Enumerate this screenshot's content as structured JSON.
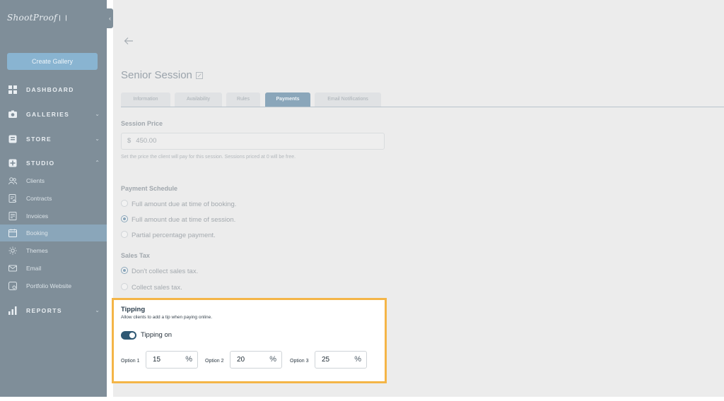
{
  "sidebar": {
    "logo_text": "ShootProof",
    "create_button": "Create Gallery",
    "sections": [
      {
        "label": "DASHBOARD",
        "icon": "grid-icon"
      },
      {
        "label": "GALLERIES",
        "icon": "camera-icon"
      },
      {
        "label": "STORE",
        "icon": "store-icon"
      },
      {
        "label": "STUDIO",
        "icon": "studio-icon"
      },
      {
        "label": "REPORTS",
        "icon": "bar-chart-icon"
      }
    ],
    "studio_items": [
      {
        "label": "Clients",
        "icon": "users-icon"
      },
      {
        "label": "Contracts",
        "icon": "contract-icon"
      },
      {
        "label": "Invoices",
        "icon": "invoice-icon"
      },
      {
        "label": "Booking",
        "icon": "calendar-icon"
      },
      {
        "label": "Themes",
        "icon": "sun-icon"
      },
      {
        "label": "Email",
        "icon": "mail-icon"
      },
      {
        "label": "Portfolio Website",
        "icon": "website-icon"
      }
    ],
    "active_item": "Booking"
  },
  "page": {
    "title": "Senior Session",
    "tabs": [
      {
        "label": "Information"
      },
      {
        "label": "Availability"
      },
      {
        "label": "Rules"
      },
      {
        "label": "Payments"
      },
      {
        "label": "Email Notifications"
      }
    ],
    "active_tab": "Payments"
  },
  "session_price": {
    "label": "Session Price",
    "currency": "$",
    "value": "450.00",
    "help": "Set the price the client will pay for this session. Sessions priced at 0 will be free."
  },
  "payment_schedule": {
    "label": "Payment Schedule",
    "options": [
      {
        "label": "Full amount due at time of booking.",
        "checked": false
      },
      {
        "label": "Full amount due at time of session.",
        "checked": true
      },
      {
        "label": "Partial percentage payment.",
        "checked": false
      }
    ]
  },
  "sales_tax": {
    "label": "Sales Tax",
    "options": [
      {
        "label": "Don't collect sales tax.",
        "checked": true
      },
      {
        "label": "Collect sales tax.",
        "checked": false
      }
    ]
  },
  "tipping": {
    "title": "Tipping",
    "subtitle": "Allow clients to add a tip when paying online.",
    "toggle_label": "Tipping on",
    "enabled": true,
    "options": [
      {
        "label": "Option 1",
        "value": "15",
        "unit": "%"
      },
      {
        "label": "Option 2",
        "value": "20",
        "unit": "%"
      },
      {
        "label": "Option 3",
        "value": "25",
        "unit": "%"
      }
    ]
  },
  "colors": {
    "highlight": "#f4b547",
    "toggle_on": "#2f5873",
    "sidebar": "#7f8e99",
    "active_tab": "#8aa6ba"
  }
}
